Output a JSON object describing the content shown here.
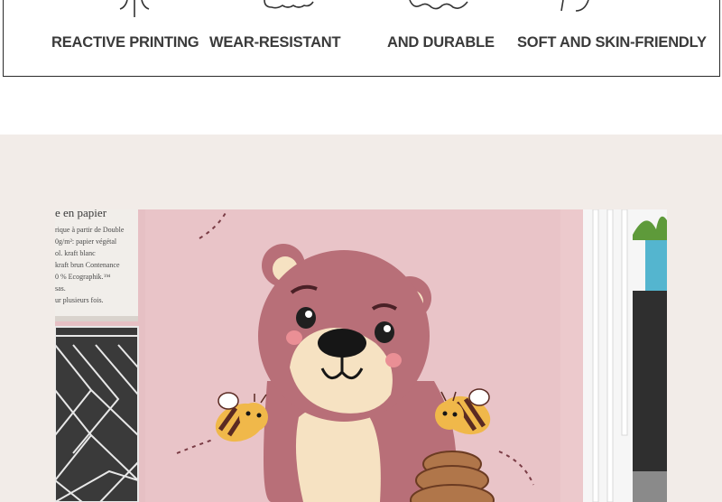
{
  "features": [
    {
      "label": "REACTIVE PRINTING",
      "icon": "leaf-icon"
    },
    {
      "label": "WEAR-RESISTANT",
      "icon": "cloud-icon"
    },
    {
      "label": "AND DURABLE",
      "icon": "wave-icon"
    },
    {
      "label": "SOFT AND SKIN-FRIENDLY",
      "icon": "curve-icon"
    }
  ],
  "photo": {
    "subject": "pink blanket with bear and bee print",
    "paper_text": [
      "e en papier",
      "rique à partir de Double",
      "0g/m²: papier végétal",
      "ol. kraft blanc",
      "kraft brun Contenance",
      "0 %  Ecographik.™",
      "sas.",
      "ur plusieurs fois."
    ]
  },
  "colors": {
    "section_bg": "#f2ece8",
    "blanket_pink": "#e9c4c8",
    "bear_body": "#b86f78",
    "bear_muzzle": "#f6e2c2",
    "outline": "#2b2b2b"
  }
}
